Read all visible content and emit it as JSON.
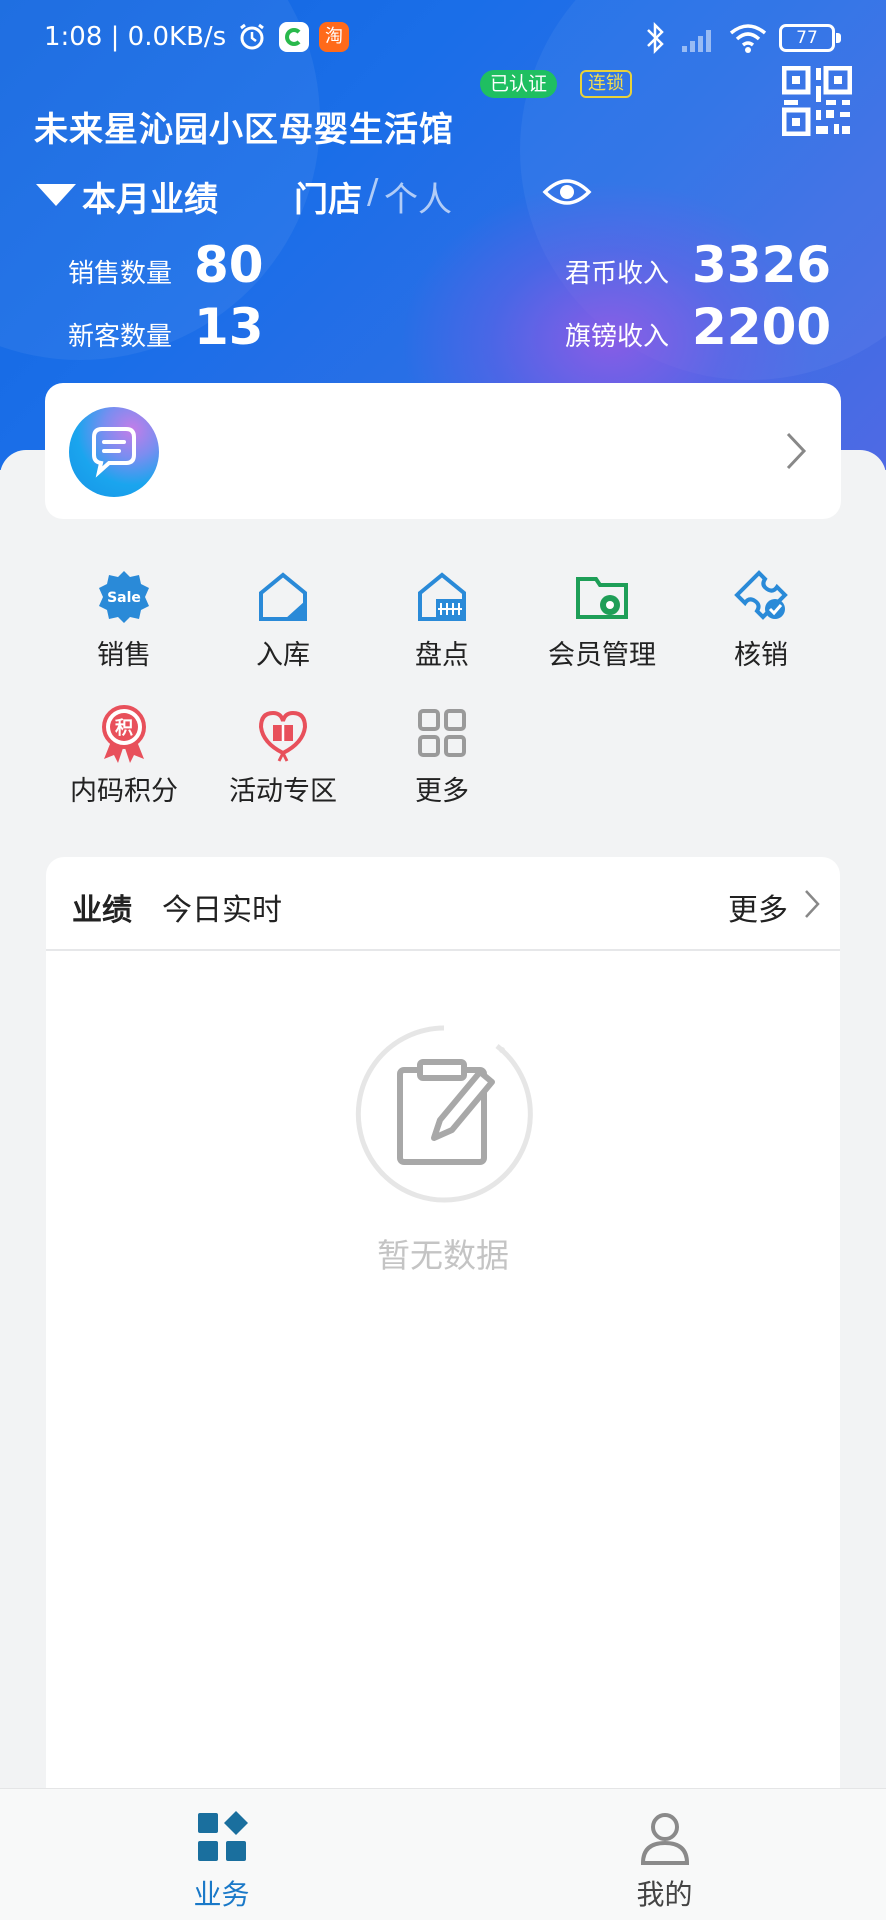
{
  "status_bar": {
    "time_speed": "1:08 | 0.0KB/s",
    "app_badge": "淘",
    "battery": "77"
  },
  "header": {
    "verified_badge": "已认证",
    "chain_badge": "连锁",
    "store_name": "未来星沁园小区母婴生活馆",
    "period_label": "本月业绩",
    "scope_store": "门店",
    "scope_sep": "/",
    "scope_personal": "个人",
    "stats": {
      "sales_qty_label": "销售数量",
      "sales_qty_value": "80",
      "new_customers_label": "新客数量",
      "new_customers_value": "13",
      "coin_income_label": "君币收入",
      "coin_income_value": "3326",
      "flagship_income_label": "旗镑收入",
      "flagship_income_value": "2200"
    }
  },
  "message_card": {
    "text": ""
  },
  "grid": {
    "items": [
      {
        "label": "销售",
        "icon": "sale-badge-icon"
      },
      {
        "label": "入库",
        "icon": "stock-in-icon"
      },
      {
        "label": "盘点",
        "icon": "inventory-icon"
      },
      {
        "label": "会员管理",
        "icon": "member-management-icon"
      },
      {
        "label": "核销",
        "icon": "ticket-verify-icon"
      },
      {
        "label": "内码积分",
        "icon": "points-badge-icon"
      },
      {
        "label": "活动专区",
        "icon": "gift-activity-icon"
      },
      {
        "label": "更多",
        "icon": "more-grid-icon"
      }
    ],
    "sale_icon_text": "Sale",
    "points_icon_text": "积"
  },
  "performance_card": {
    "title": "业绩",
    "subtitle": "今日实时",
    "more": "更多",
    "empty_text": "暂无数据"
  },
  "bottom_nav": {
    "items": [
      {
        "label": "业务",
        "active": true
      },
      {
        "label": "我的",
        "active": false
      }
    ]
  },
  "colors": {
    "header_blue": "#1a6ee8",
    "accent_blue": "#1a79c8",
    "verified_green": "#1fbf61",
    "chain_gold": "#e8d23a",
    "icon_blue": "#2a8ad8",
    "icon_green": "#1e9e57",
    "icon_red": "#e8505b",
    "empty_gray": "#c4c4c4"
  }
}
